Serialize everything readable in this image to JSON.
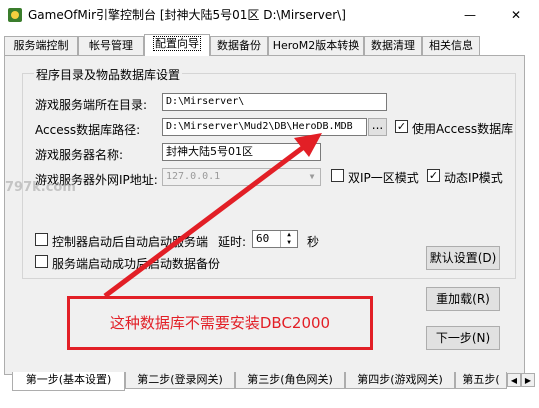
{
  "window": {
    "title": "GameOfMir引擎控制台 [封神大陆5号01区 D:\\Mirserver\\]",
    "minimize_label": "—",
    "close_label": "✕"
  },
  "tabs": [
    {
      "label": "服务端控制"
    },
    {
      "label": "帐号管理"
    },
    {
      "label": "配置向导"
    },
    {
      "label": "数据备份"
    },
    {
      "label": "HeroM2版本转换"
    },
    {
      "label": "数据清理"
    },
    {
      "label": "相关信息"
    }
  ],
  "group": {
    "title": "程序目录及物品数据库设置"
  },
  "fields": {
    "server_dir_label": "游戏服务端所在目录:",
    "server_dir_value": "D:\\Mirserver\\",
    "access_path_label": "Access数据库路径:",
    "access_path_value": "D:\\Mirserver\\Mud2\\DB\\HeroDB.MDB",
    "browse_label": "...",
    "use_access_label": "使用Access数据库",
    "use_access_checked": "✓",
    "server_name_label": "游戏服务器名称:",
    "server_name_value": "封神大陆5号01区",
    "external_ip_label": "游戏服务器外网IP地址:",
    "external_ip_value": "127.0.0.1",
    "dual_ip_label": "双IP一区模式",
    "dynamic_ip_label": "动态IP模式",
    "dynamic_ip_checked": "✓",
    "auto_start_label": "控制器启动后自动启动服务端",
    "delay_label": "延时:",
    "delay_value": "60",
    "seconds_label": "秒",
    "auto_backup_label": "服务端启动成功后启动数据备份"
  },
  "buttons": {
    "default_settings": "默认设置(D)",
    "reload": "重加载(R)",
    "next_step": "下一步(N)"
  },
  "annotation": {
    "text": "这种数据库不需要安装DBC2000"
  },
  "watermark": "797k.com",
  "step_tabs": [
    {
      "label": "第一步(基本设置)"
    },
    {
      "label": "第二步(登录网关)"
    },
    {
      "label": "第三步(角色网关)"
    },
    {
      "label": "第四步(游戏网关)"
    },
    {
      "label": "第五步("
    }
  ],
  "colors": {
    "accent_red": "#e21f26",
    "panel_bg": "#f0f0f0"
  }
}
